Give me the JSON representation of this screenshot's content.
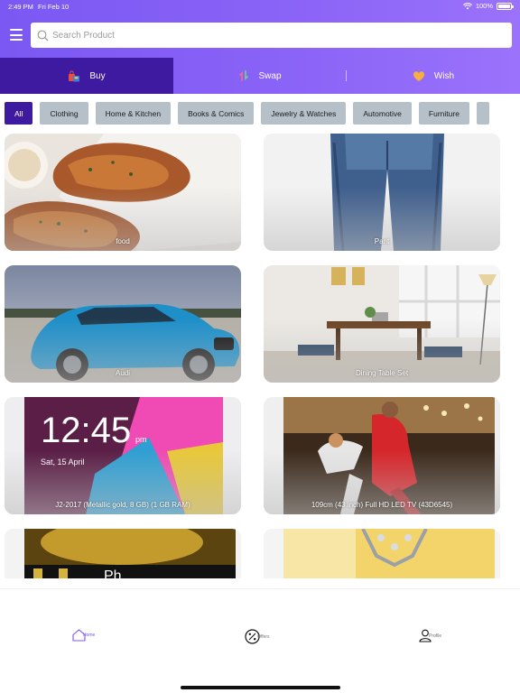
{
  "status": {
    "time": "2:49 PM",
    "date": "Fri Feb 10",
    "battery": "100%"
  },
  "search": {
    "placeholder": "Search Product"
  },
  "tabs": [
    {
      "label": "Buy",
      "icon": "shopping-bags-icon",
      "active": true
    },
    {
      "label": "Swap",
      "icon": "swap-arrows-icon",
      "active": false
    },
    {
      "label": "Wish",
      "icon": "heart-icon",
      "active": false
    }
  ],
  "categories": [
    {
      "label": "All",
      "active": true
    },
    {
      "label": "Clothing"
    },
    {
      "label": "Home & Kitchen"
    },
    {
      "label": "Books & Comics"
    },
    {
      "label": "Jewelry & Watches"
    },
    {
      "label": "Automotive"
    },
    {
      "label": "Furniture"
    }
  ],
  "products": [
    {
      "label": "food"
    },
    {
      "label": "Pant"
    },
    {
      "label": "Audi"
    },
    {
      "label": "Dining Table Set"
    },
    {
      "label": "J2-2017 (Metallic gold, 8 GB)  (1 GB RAM)"
    },
    {
      "label": "109cm (43 inch) Full HD LED TV  (43D6545)"
    },
    {
      "label": ""
    },
    {
      "label": ""
    }
  ],
  "bottom_nav": [
    {
      "label": "Home",
      "icon": "home-icon",
      "active": true
    },
    {
      "label": "Offers",
      "icon": "discount-icon",
      "active": false
    },
    {
      "label": "Profile",
      "icon": "profile-icon",
      "active": false
    }
  ],
  "colors": {
    "header": "#8a63f7",
    "active_tab": "#3e1aa1",
    "chip": "#b5c0c8"
  }
}
